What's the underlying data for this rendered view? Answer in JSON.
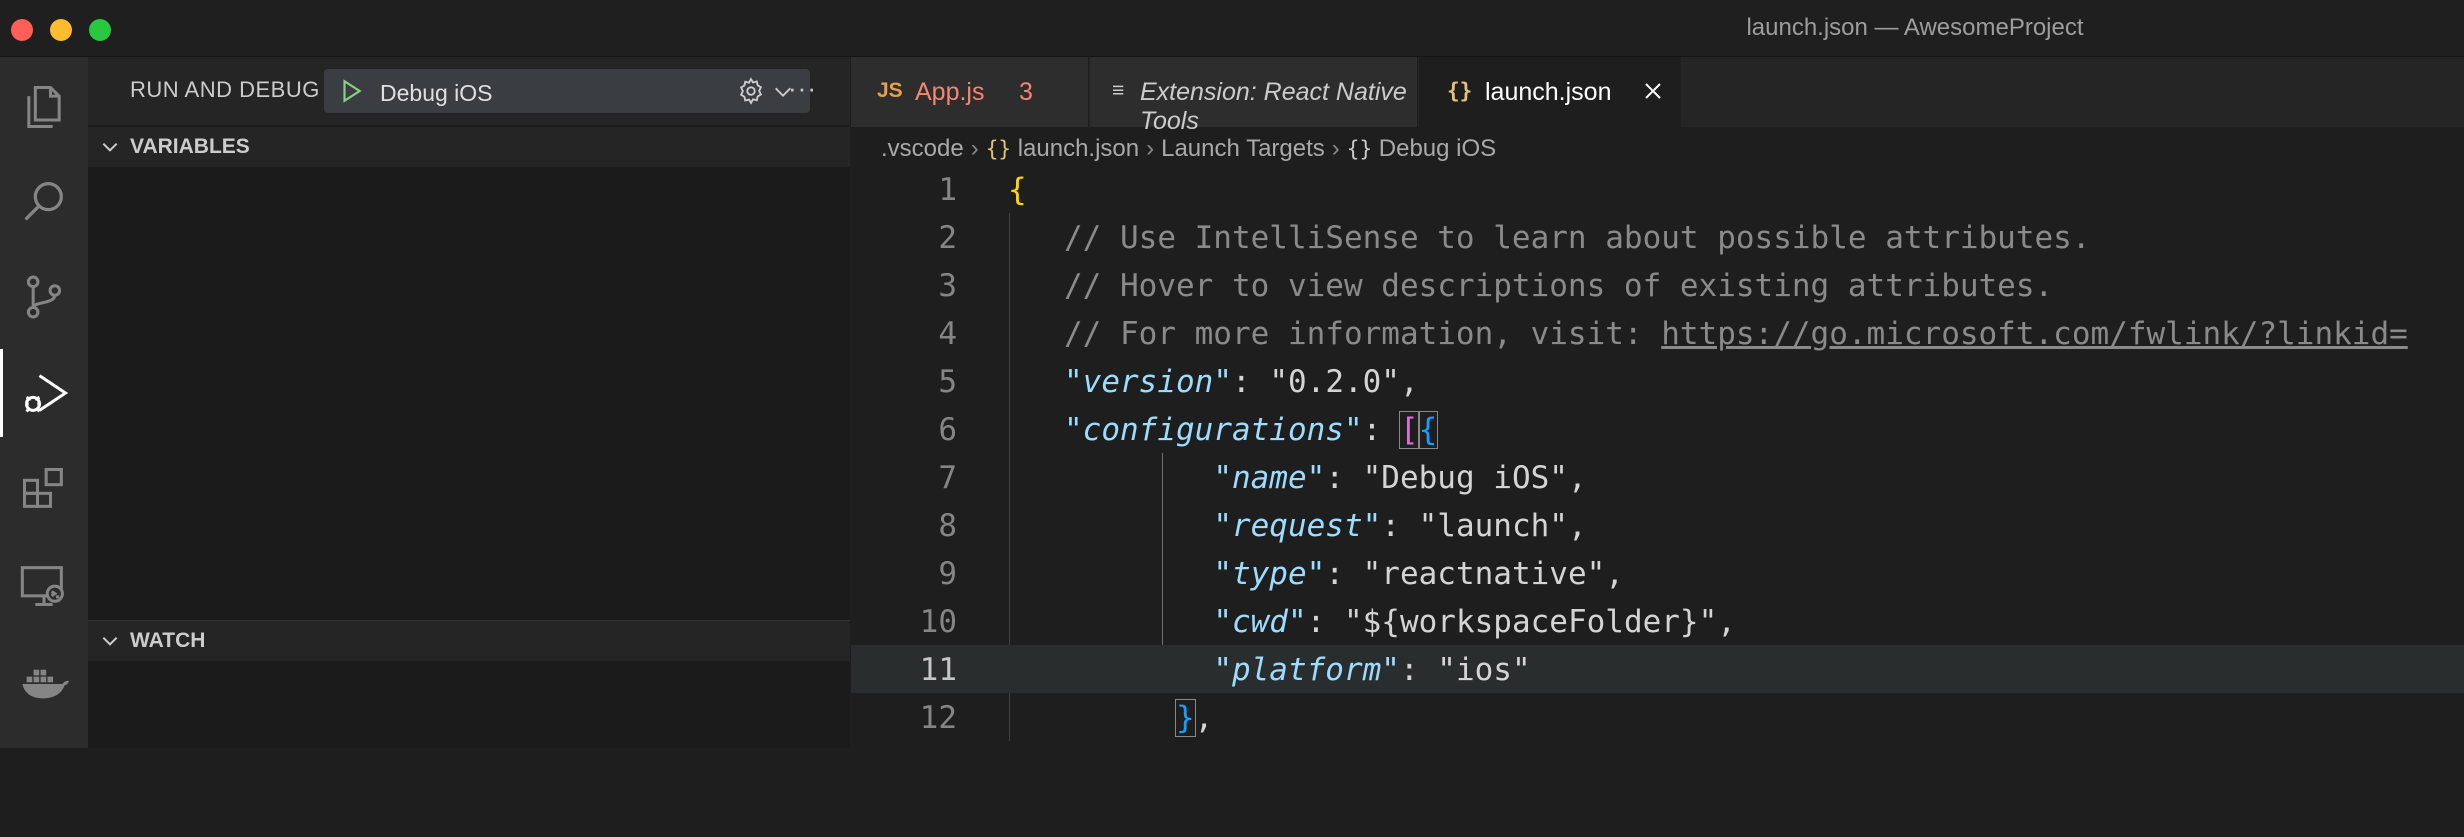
{
  "window": {
    "title": "launch.json — AwesomeProject"
  },
  "activity_bar": {
    "items": [
      "explorer-icon",
      "search-icon",
      "source-control-icon",
      "run-debug-icon",
      "extensions-icon",
      "remote-explorer-icon",
      "docker-icon"
    ],
    "active": "run-debug-icon"
  },
  "sidebar": {
    "title": "RUN AND DEBUG",
    "config_selected": "Debug iOS",
    "sections": {
      "variables": "VARIABLES",
      "watch": "WATCH"
    }
  },
  "tabs": [
    {
      "icon": "JS",
      "label": "App.js",
      "badge": "3"
    },
    {
      "icon": "≡",
      "label": "Extension: React Native Tools"
    },
    {
      "icon": "{}",
      "label": "launch.json",
      "active": true
    }
  ],
  "breadcrumb": {
    "folder": ".vscode",
    "file": "launch.json",
    "section": "Launch Targets",
    "item": "Debug iOS"
  },
  "code": {
    "line_numbers": [
      "1",
      "2",
      "3",
      "4",
      "5",
      "6",
      "7",
      "8",
      "9",
      "10",
      "11",
      "12"
    ],
    "current_line": "11",
    "comment1": "// Use IntelliSense to learn about possible attributes.",
    "comment2": "// Hover to view descriptions of existing attributes.",
    "comment3_prefix": "// For more information, visit: ",
    "comment3_link": "https://go.microsoft.com/fwlink/?linkid=",
    "version_key": "version",
    "version_val": "\"0.2.0\"",
    "configs_key": "configurations",
    "name_key": "name",
    "name_val": "\"Debug iOS\"",
    "request_key": "request",
    "request_val": "\"launch\"",
    "type_key": "type",
    "type_val": "\"reactnative\"",
    "cwd_key": "cwd",
    "cwd_val": "\"${workspaceFolder}\"",
    "platform_key": "platform",
    "platform_val": "\"ios\""
  },
  "colors": {
    "accent_play": "#89d185",
    "tab_js": "#e5a04b",
    "error_badge": "#f48771"
  }
}
